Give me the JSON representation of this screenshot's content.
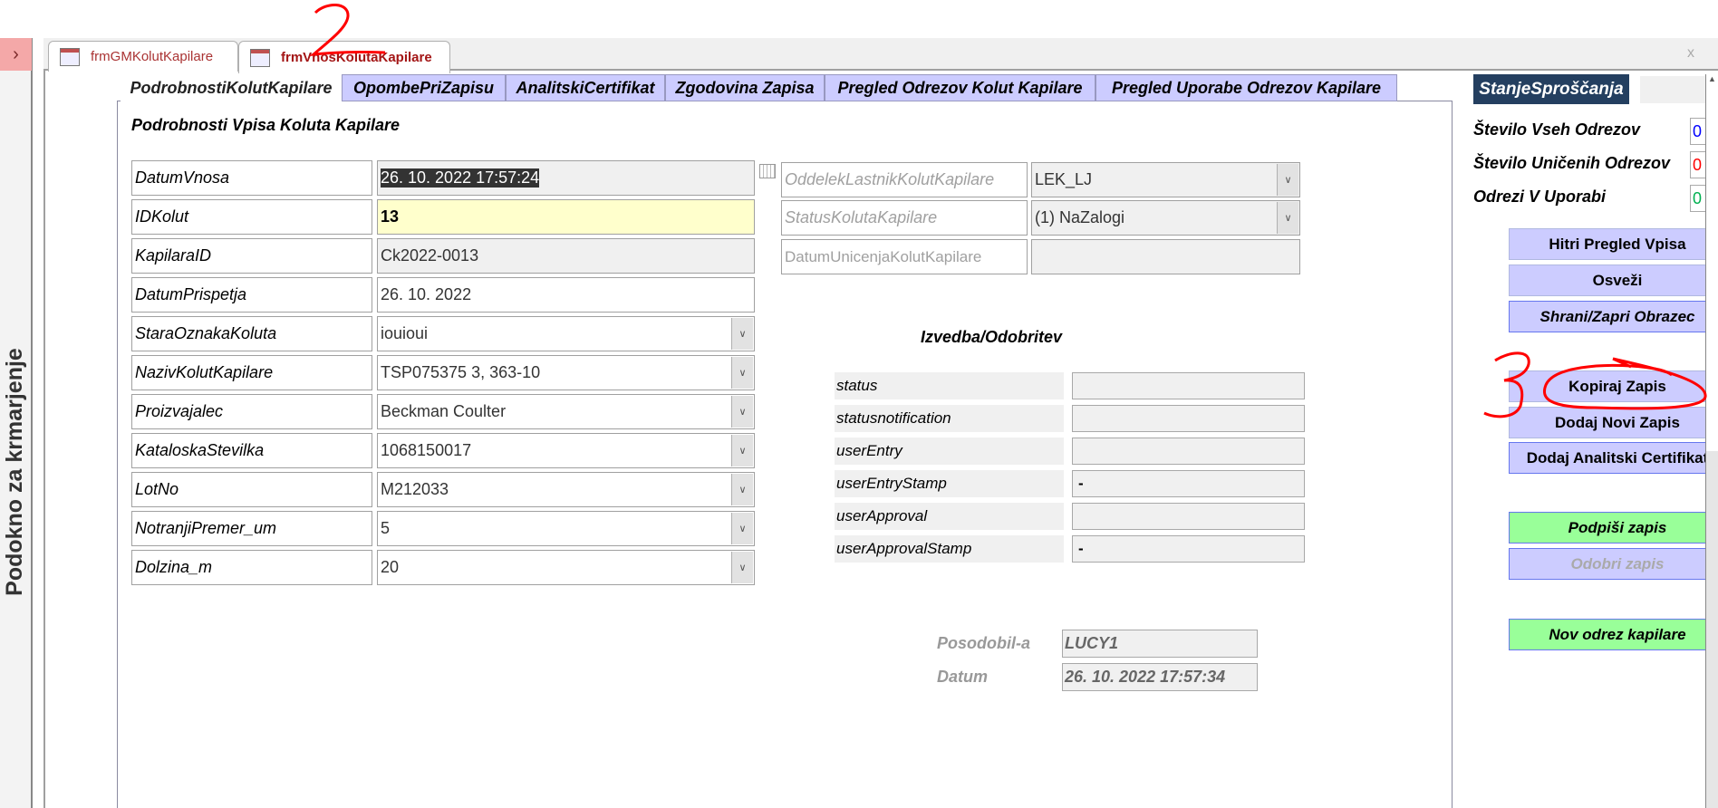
{
  "nav_pane": {
    "label": "Podokno za krmarjenje",
    "toggle_icon": "chevron-right-icon"
  },
  "doc_tabs": [
    {
      "label": "frmGMKolutKapilare",
      "active": false
    },
    {
      "label": "frmVnosKolutaKapilare",
      "active": true
    }
  ],
  "close_label": "x",
  "inner_tabs": [
    "PodrobnostiKolutKapilare",
    "OpombePriZapisu",
    "AnalitskiCertifikat",
    "Zgodovina Zapisa",
    "Pregled Odrezov Kolut Kapilare",
    "Pregled Uporabe Odrezov Kapilare"
  ],
  "section_title": "Podrobnosti Vpisa Koluta Kapilare",
  "fields": [
    {
      "label": "DatumVnosa",
      "value": "26. 10. 2022 17:57:24"
    },
    {
      "label": "IDKolut",
      "value": "13"
    },
    {
      "label": "KapilaraID",
      "value": "Ck2022-0013"
    },
    {
      "label": "DatumPrispetja",
      "value": "26. 10. 2022"
    },
    {
      "label": "StaraOznakaKoluta",
      "value": "iouioui"
    },
    {
      "label": "NazivKolutKapilare",
      "value": "TSP075375 3, 363-10"
    },
    {
      "label": "Proizvajalec",
      "value": "Beckman Coulter"
    },
    {
      "label": "KataloskaStevilka",
      "value": "1068150017"
    },
    {
      "label": "LotNo",
      "value": "M212033"
    },
    {
      "label": "NotranjiPremer_um",
      "value": "5"
    },
    {
      "label": "Dolzina_m",
      "value": "20"
    }
  ],
  "right_fields": [
    {
      "label": "OddelekLastnikKolutKapilare",
      "value": "LEK_LJ"
    },
    {
      "label": "StatusKolutaKapilare",
      "value": "(1) NaZalogi"
    },
    {
      "label": "DatumUnicenjaKolutKapilare",
      "value": ""
    }
  ],
  "approval": {
    "title": "Izvedba/Odobritev",
    "rows": [
      {
        "label": "status",
        "value": ""
      },
      {
        "label": "statusnotification",
        "value": ""
      },
      {
        "label": "userEntry",
        "value": ""
      },
      {
        "label": "userEntryStamp",
        "value": "-"
      },
      {
        "label": "userApproval",
        "value": ""
      },
      {
        "label": "userApprovalStamp",
        "value": "-"
      }
    ]
  },
  "updated": {
    "by_label": "Posodobil-a",
    "by_value": "LUCY1",
    "date_label": "Datum",
    "date_value": "26. 10. 2022 17:57:34"
  },
  "side": {
    "stanje": "StanjeSproščanja",
    "stats": [
      {
        "label": "Število Vseh Odrezov",
        "value": "0",
        "color": "#0000ff"
      },
      {
        "label": "Število Uničenih Odrezov",
        "value": "0",
        "color": "#ff0000"
      },
      {
        "label": "Odrezi V Uporabi",
        "value": "0",
        "color": "#00b050"
      }
    ],
    "buttons": [
      "Hitri Pregled Vpisa",
      "Osveži",
      "Shrani/Zapri Obrazec",
      "Kopiraj Zapis",
      "Dodaj Novi Zapis",
      "Dodaj Analitski Certifikat",
      "Podpiši zapis",
      "Odobri zapis",
      "Nov odrez kapilare"
    ]
  },
  "annotations": [
    "2",
    "3"
  ]
}
